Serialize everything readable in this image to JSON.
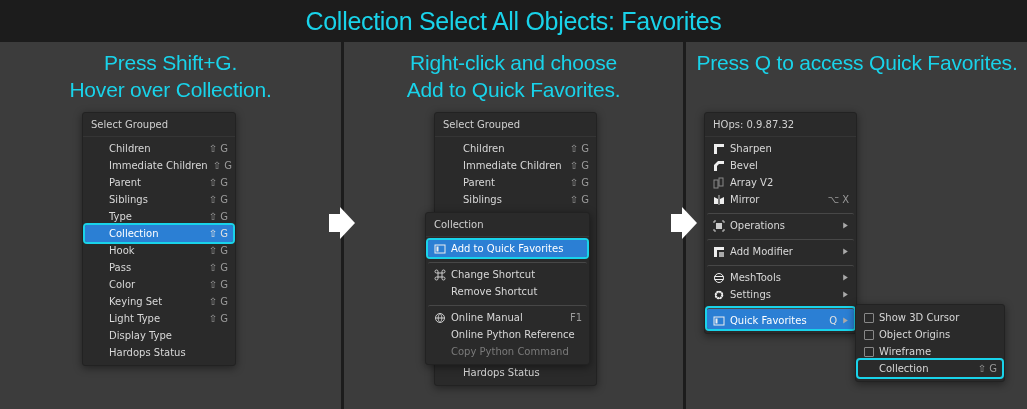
{
  "title": "Collection Select All Objects: Favorites",
  "panels": [
    {
      "caption": [
        "Press Shift+G.",
        "Hover over Collection."
      ],
      "menu": {
        "header": "Select Grouped",
        "items": [
          {
            "label": "Children",
            "shortcut": "⇧ G",
            "selected": false,
            "outlined": false
          },
          {
            "label": "Immediate Children",
            "shortcut": "⇧ G",
            "selected": false,
            "outlined": false
          },
          {
            "label": "Parent",
            "shortcut": "⇧ G",
            "selected": false,
            "outlined": false
          },
          {
            "label": "Siblings",
            "shortcut": "⇧ G",
            "selected": false,
            "outlined": false
          },
          {
            "label": "Type",
            "shortcut": "⇧ G",
            "selected": false,
            "outlined": false
          },
          {
            "label": "Collection",
            "shortcut": "⇧ G",
            "selected": true,
            "outlined": true
          },
          {
            "label": "Hook",
            "shortcut": "⇧ G",
            "selected": false,
            "outlined": false
          },
          {
            "label": "Pass",
            "shortcut": "⇧ G",
            "selected": false,
            "outlined": false
          },
          {
            "label": "Color",
            "shortcut": "⇧ G",
            "selected": false,
            "outlined": false
          },
          {
            "label": "Keying Set",
            "shortcut": "⇧ G",
            "selected": false,
            "outlined": false
          },
          {
            "label": "Light Type",
            "shortcut": "⇧ G",
            "selected": false,
            "outlined": false
          },
          {
            "label": "Display Type",
            "selected": false,
            "outlined": false
          },
          {
            "label": "Hardops Status",
            "selected": false,
            "outlined": false
          }
        ]
      }
    },
    {
      "caption": [
        "Right-click and choose",
        "Add to Quick Favorites."
      ],
      "menu": {
        "header": "Select Grouped",
        "items": [
          {
            "label": "Children",
            "shortcut": "⇧ G",
            "selected": false,
            "outlined": false
          },
          {
            "label": "Immediate Children",
            "shortcut": "⇧ G",
            "selected": false,
            "outlined": false
          },
          {
            "label": "Parent",
            "shortcut": "⇧ G",
            "selected": false,
            "outlined": false
          },
          {
            "label": "Siblings",
            "shortcut": "⇧ G",
            "selected": false,
            "outlined": false
          },
          {
            "label": "Hardops Status",
            "selected": false,
            "outlined": false,
            "gap_before": true
          }
        ]
      },
      "context_menu": {
        "header": "Collection",
        "items": [
          {
            "label": "Add to Quick Favorites",
            "selected": true,
            "outlined": true,
            "disabled": false
          },
          {
            "label": "Change Shortcut",
            "selected": false,
            "outlined": false,
            "disabled": false,
            "separator_before": true
          },
          {
            "label": "Remove Shortcut",
            "selected": false,
            "outlined": false,
            "disabled": false
          },
          {
            "label": "Online Manual",
            "shortcut": "F1",
            "selected": false,
            "outlined": false,
            "disabled": false,
            "separator_before": true
          },
          {
            "label": "Online Python Reference",
            "selected": false,
            "outlined": false,
            "disabled": false
          },
          {
            "label": "Copy Python Command",
            "selected": false,
            "outlined": false,
            "disabled": true
          }
        ]
      }
    },
    {
      "caption": [
        "Press Q to access Quick Favorites."
      ],
      "menu": {
        "header": "HOps: 0.9.87.32",
        "items": [
          {
            "label": "Sharpen",
            "selected": false,
            "outlined": false
          },
          {
            "label": "Bevel",
            "selected": false,
            "outlined": false
          },
          {
            "label": "Array V2",
            "selected": false,
            "outlined": false
          },
          {
            "label": "Mirror",
            "shortcut": "⌥ X",
            "selected": false,
            "outlined": false
          },
          {
            "label": "Operations",
            "selected": false,
            "outlined": false,
            "separator_before": true,
            "has_submenu": true
          },
          {
            "label": "Add Modifier",
            "selected": false,
            "outlined": false,
            "separator_before": true,
            "has_submenu": true
          },
          {
            "label": "MeshTools",
            "selected": false,
            "outlined": false,
            "separator_before": true,
            "has_submenu": true
          },
          {
            "label": "Settings",
            "selected": false,
            "outlined": false,
            "has_submenu": true
          },
          {
            "label": "Quick Favorites",
            "shortcut": "Q",
            "selected": true,
            "outlined": true,
            "separator_before": true,
            "has_submenu": true
          }
        ]
      },
      "submenu": {
        "items": [
          {
            "kind": "toggle",
            "label": "Show 3D Cursor",
            "checked": false,
            "selected": false,
            "outlined": false
          },
          {
            "kind": "toggle",
            "label": "Object Origins",
            "checked": false,
            "selected": false,
            "outlined": false
          },
          {
            "kind": "toggle",
            "label": "Wireframe",
            "checked": false,
            "selected": false,
            "outlined": false
          },
          {
            "kind": "action",
            "label": "Collection",
            "shortcut": "⇧ G",
            "selected": false,
            "outlined": true
          }
        ]
      }
    }
  ]
}
